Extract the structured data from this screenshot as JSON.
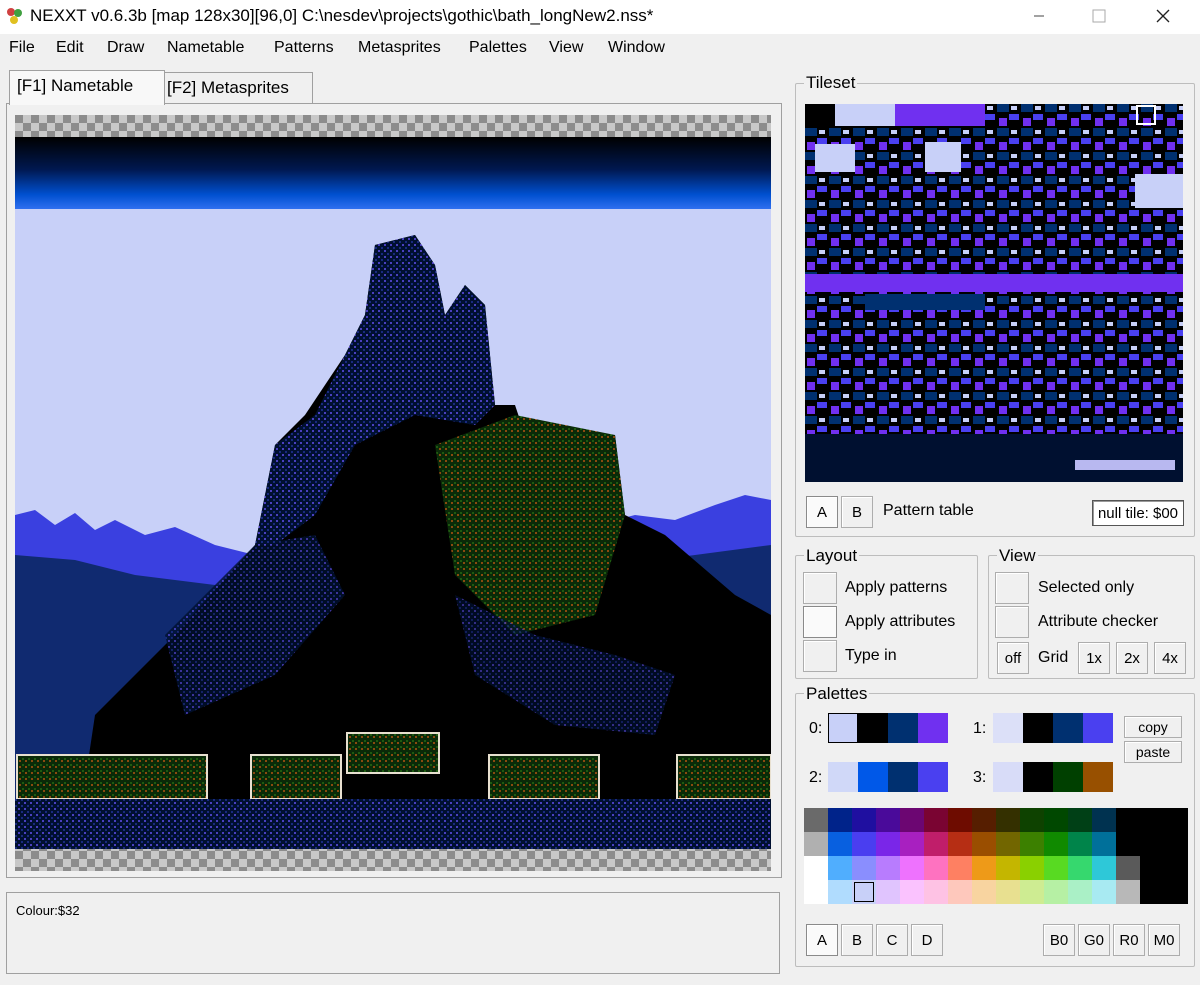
{
  "window": {
    "title": "NEXXT v0.6.3b  [map 128x30][96,0] C:\\nesdev\\projects\\gothic\\bath_longNew2.nss*",
    "minimize_icon": "minimize-icon",
    "maximize_icon": "maximize-icon",
    "close_icon": "close-icon"
  },
  "menu": [
    "File",
    "Edit",
    "Draw",
    "Nametable",
    "Patterns",
    "Metasprites",
    "Palettes",
    "View",
    "Window"
  ],
  "tabs": [
    {
      "label": "[F1] Nametable",
      "active": true
    },
    {
      "label": "[F2] Metasprites",
      "active": false
    }
  ],
  "status": {
    "text": "Colour:$32"
  },
  "tileset": {
    "group_label": "Tileset",
    "bank_a": "A",
    "bank_b": "B",
    "pattern_table_label": "Pattern table",
    "null_tile": "null tile: $00"
  },
  "layout_group": {
    "label": "Layout",
    "apply_patterns": "Apply patterns",
    "apply_attributes": "Apply attributes",
    "type_in": "Type in"
  },
  "view_group": {
    "label": "View",
    "selected_only": "Selected only",
    "attribute_checker": "Attribute checker",
    "off": "off",
    "grid": "Grid",
    "zoom": [
      "1x",
      "2x",
      "4x"
    ]
  },
  "palettes": {
    "label": "Palettes",
    "rows": [
      {
        "label": "0:",
        "colors": [
          "#c8d0f8",
          "#000000",
          "#003070",
          "#7030f0"
        ]
      },
      {
        "label": "1:",
        "colors": [
          "#dce0f8",
          "#000000",
          "#003070",
          "#4a40f0"
        ]
      },
      {
        "label": "2:",
        "colors": [
          "#d0d8f8",
          "#0058e8",
          "#003070",
          "#4a40f0"
        ]
      },
      {
        "label": "3:",
        "colors": [
          "#d8dcf8",
          "#000000",
          "#004000",
          "#985000"
        ]
      }
    ],
    "copy": "copy",
    "paste": "paste",
    "sub_buttons": [
      "A",
      "B",
      "C",
      "D"
    ],
    "emphasis_buttons": [
      "B0",
      "G0",
      "R0",
      "M0"
    ]
  },
  "master_palette": [
    [
      "#6a6a6a",
      "#00238a",
      "#1f0fa0",
      "#4a0a9a",
      "#6c0672",
      "#7a0432",
      "#6e0c00",
      "#561e00",
      "#343000",
      "#0e4200",
      "#004800",
      "#004016",
      "#003250",
      "#000000",
      "#000000",
      "#000000"
    ],
    [
      "#b0b0b0",
      "#0860e0",
      "#4a3ef0",
      "#7a26e8",
      "#a820c0",
      "#c01e6a",
      "#b62e14",
      "#9a4e00",
      "#726600",
      "#3c8000",
      "#108a00",
      "#00844a",
      "#00709a",
      "#000000",
      "#000000",
      "#000000"
    ],
    [
      "#ffffff",
      "#50aefe",
      "#8a8efe",
      "#b87cfe",
      "#ee72fe",
      "#fe72c0",
      "#fe8062",
      "#ee9a18",
      "#c4b600",
      "#8ad000",
      "#58da22",
      "#36d86e",
      "#2ec8d8",
      "#5a5a5a",
      "#000000",
      "#000000"
    ],
    [
      "#ffffff",
      "#b0dcfe",
      "#c8d0f8",
      "#e0c4fe",
      "#fac2fe",
      "#fec2e4",
      "#fec8bc",
      "#f8d4a0",
      "#e8e090",
      "#ceec92",
      "#b6f0a4",
      "#aaf0c6",
      "#a8eaf2",
      "#b8b8b8",
      "#000000",
      "#000000"
    ]
  ],
  "selected_master": {
    "row": 3,
    "col": 2
  }
}
